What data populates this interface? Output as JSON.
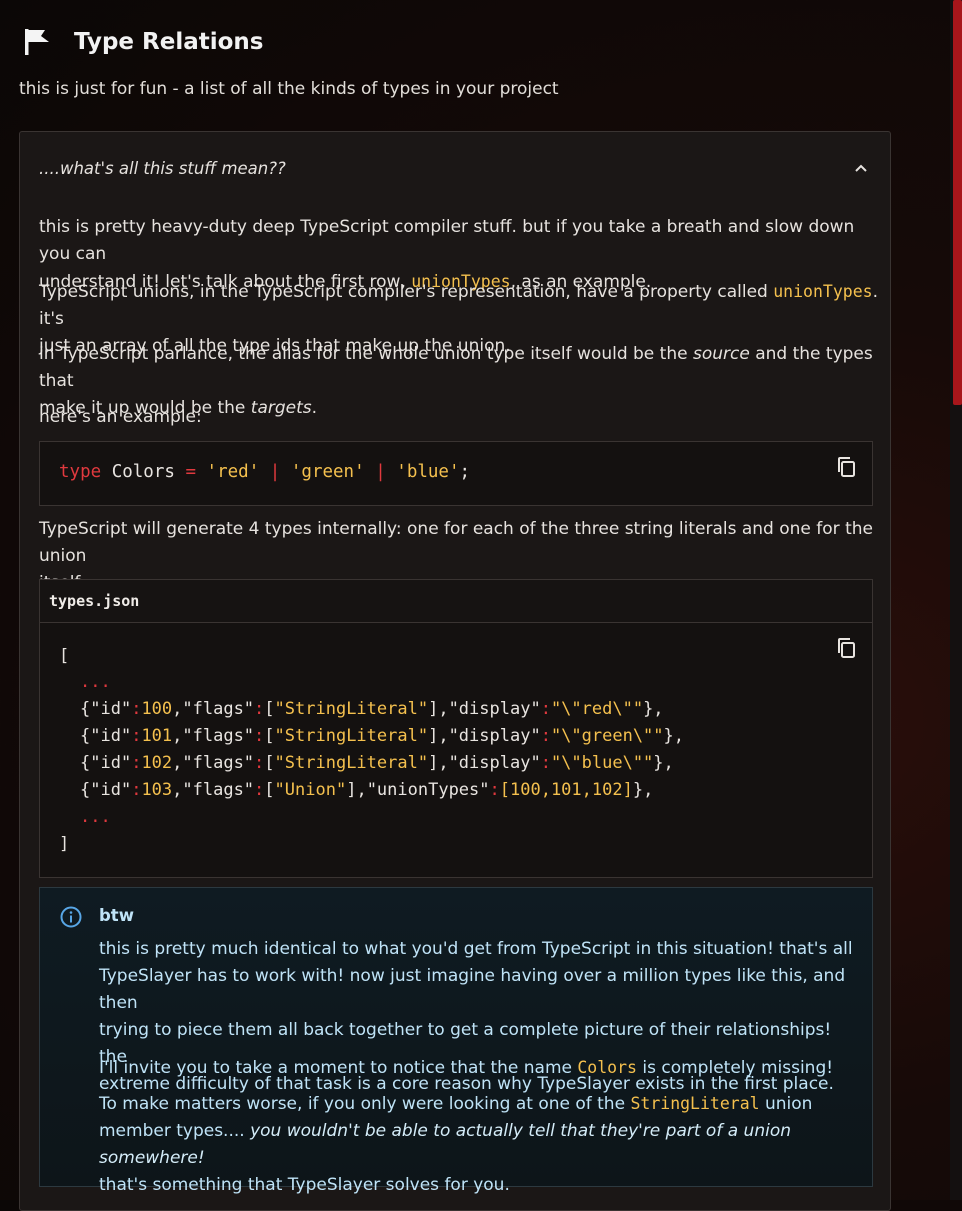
{
  "header": {
    "title": "Type Relations",
    "flag_icon": "flag-icon"
  },
  "subtitle": "this is just for fun - a list of all the kinds of types in your project",
  "accordion": {
    "question": "....what's all this stuff mean??",
    "chevron_icon": "chevron-up-icon"
  },
  "body": {
    "p1_a": "this is pretty heavy-duty deep TypeScript compiler stuff. but if you take a breath and slow down you can",
    "p1_b": "understand it! let's talk about the first row, ",
    "p1_code": "unionTypes",
    "p1_c": ", as an example.",
    "p2_a": "TypeScript unions, in the TypeScript compiler's representation, have a property called ",
    "p2_code": "unionTypes",
    "p2_b": ". it's",
    "p2_c": "just an array of all the type ids that make up the union.",
    "p3_a": "in TypeScript parlance, the alias for the whole union type itself would be the ",
    "p3_source": "source",
    "p3_b": " and the types that",
    "p3_c": "make it up would be the ",
    "p3_targets": "targets",
    "p3_d": ".",
    "p4": "here's an example:",
    "p5_a": "TypeScript will generate 4 types internally: one for each of the three string literals and one for the union",
    "p5_b": "itself:"
  },
  "code1": {
    "kw": "type",
    "name": " Colors ",
    "eq": "=",
    "s1": "'red'",
    "bar": "|",
    "s2": "'green'",
    "s3": "'blue'",
    "semi": ";",
    "copy_icon": "copy-icon"
  },
  "code2": {
    "filename": "types.json",
    "open": "[",
    "dots": "...",
    "close": "]",
    "rows": [
      {
        "id": "100",
        "flag": "\"StringLiteral\"",
        "key": "\"display\"",
        "val": "\"\\\"red\\\"\""
      },
      {
        "id": "101",
        "flag": "\"StringLiteral\"",
        "key": "\"display\"",
        "val": "\"\\\"green\\\"\""
      },
      {
        "id": "102",
        "flag": "\"StringLiteral\"",
        "key": "\"display\"",
        "val": "\"\\\"blue\\\"\""
      },
      {
        "id": "103",
        "flag": "\"Union\"",
        "key": "\"unionTypes\"",
        "val": "[100,101,102]"
      }
    ]
  },
  "info": {
    "title": "btw",
    "icon": "info-icon",
    "l1": "this is pretty much identical to what you'd get from TypeScript in this situation! that's all",
    "l2": "TypeSlayer has to work with! now just imagine having over a million types like this, and then",
    "l3": "trying to piece them all back together to get a complete picture of their relationships! the",
    "l4": "extreme difficulty of that task is a core reason why TypeSlayer exists in the first place.",
    "p2_a": "I'll invite you to take a moment to notice that the name ",
    "p2_code": "Colors",
    "p2_b": " is completely missing!",
    "p3_a": "To make matters worse, if you only were looking at one of the ",
    "p3_code": "StringLiteral",
    "p3_b": " union",
    "p3_c": "member types.... ",
    "p3_italic": "you wouldn't be able to actually tell that they're part of a union somewhere!",
    "p3_d": "that's something that TypeSlayer solves for you."
  }
}
